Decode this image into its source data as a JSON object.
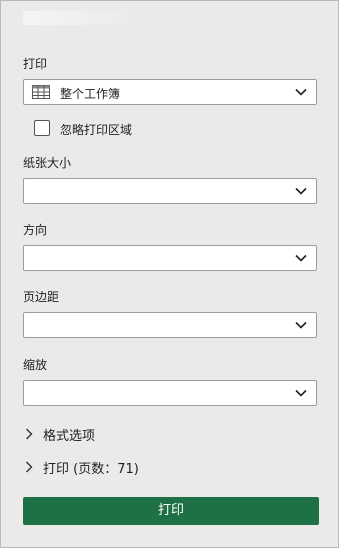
{
  "print_section": {
    "label": "打印",
    "selection": "整个工作簿",
    "icon": "table-grid-icon"
  },
  "ignore_print_area": {
    "label": "忽略打印区域",
    "checked": false
  },
  "paper_size": {
    "label": "纸张大小",
    "value": ""
  },
  "orientation": {
    "label": "方向",
    "value": ""
  },
  "margins": {
    "label": "页边距",
    "value": ""
  },
  "scaling": {
    "label": "缩放",
    "value": ""
  },
  "format_options": {
    "label": "格式选项"
  },
  "print_expander": {
    "label": "打印 (页数：71)"
  },
  "print_button": {
    "label": "打印",
    "color": "#1e7145"
  }
}
